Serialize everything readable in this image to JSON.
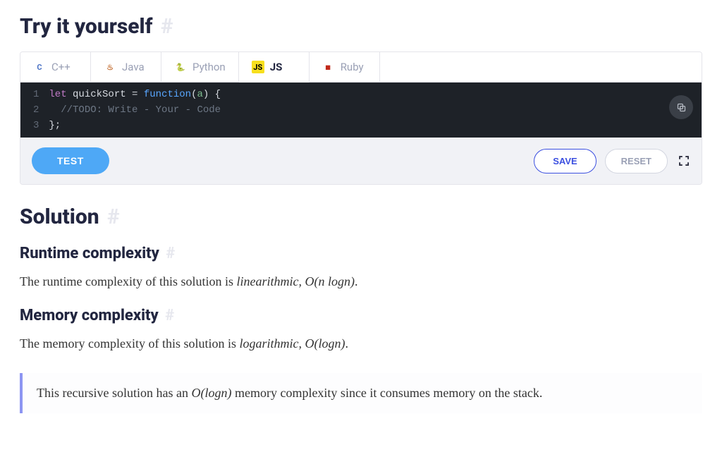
{
  "headings": {
    "try": "Try it yourself",
    "solution": "Solution",
    "runtime": "Runtime complexity",
    "memory": "Memory complexity",
    "hash": "#"
  },
  "tabs": [
    {
      "id": "cpp",
      "label": "C++",
      "active": false
    },
    {
      "id": "java",
      "label": "Java",
      "active": false
    },
    {
      "id": "python",
      "label": "Python",
      "active": false
    },
    {
      "id": "js",
      "label": "JS",
      "active": true
    },
    {
      "id": "ruby",
      "label": "Ruby",
      "active": false
    }
  ],
  "code": {
    "line_numbers": [
      "1",
      "2",
      "3"
    ],
    "l1": {
      "kw": "let",
      "id": " quickSort = ",
      "fn": "function",
      "rest1": "(",
      "param": "a",
      "rest2": ") {"
    },
    "l2": {
      "indent": "  ",
      "comment": "//TODO: Write - Your - Code"
    },
    "l3": {
      "text": "};"
    }
  },
  "toolbar": {
    "test": "TEST",
    "save": "SAVE",
    "reset": "RESET"
  },
  "body": {
    "runtime_pre": "The runtime complexity of this solution is ",
    "runtime_term": "linearithmic, ",
    "runtime_bigO": "O(n logn)",
    "runtime_post": ".",
    "memory_pre": "The memory complexity of this solution is ",
    "memory_term": "logarithmic, ",
    "memory_bigO": "O(logn)",
    "memory_post": ".",
    "callout_pre": "This recursive solution has an ",
    "callout_bigO": "O(logn)",
    "callout_post": " memory complexity since it consumes memory on the stack."
  }
}
